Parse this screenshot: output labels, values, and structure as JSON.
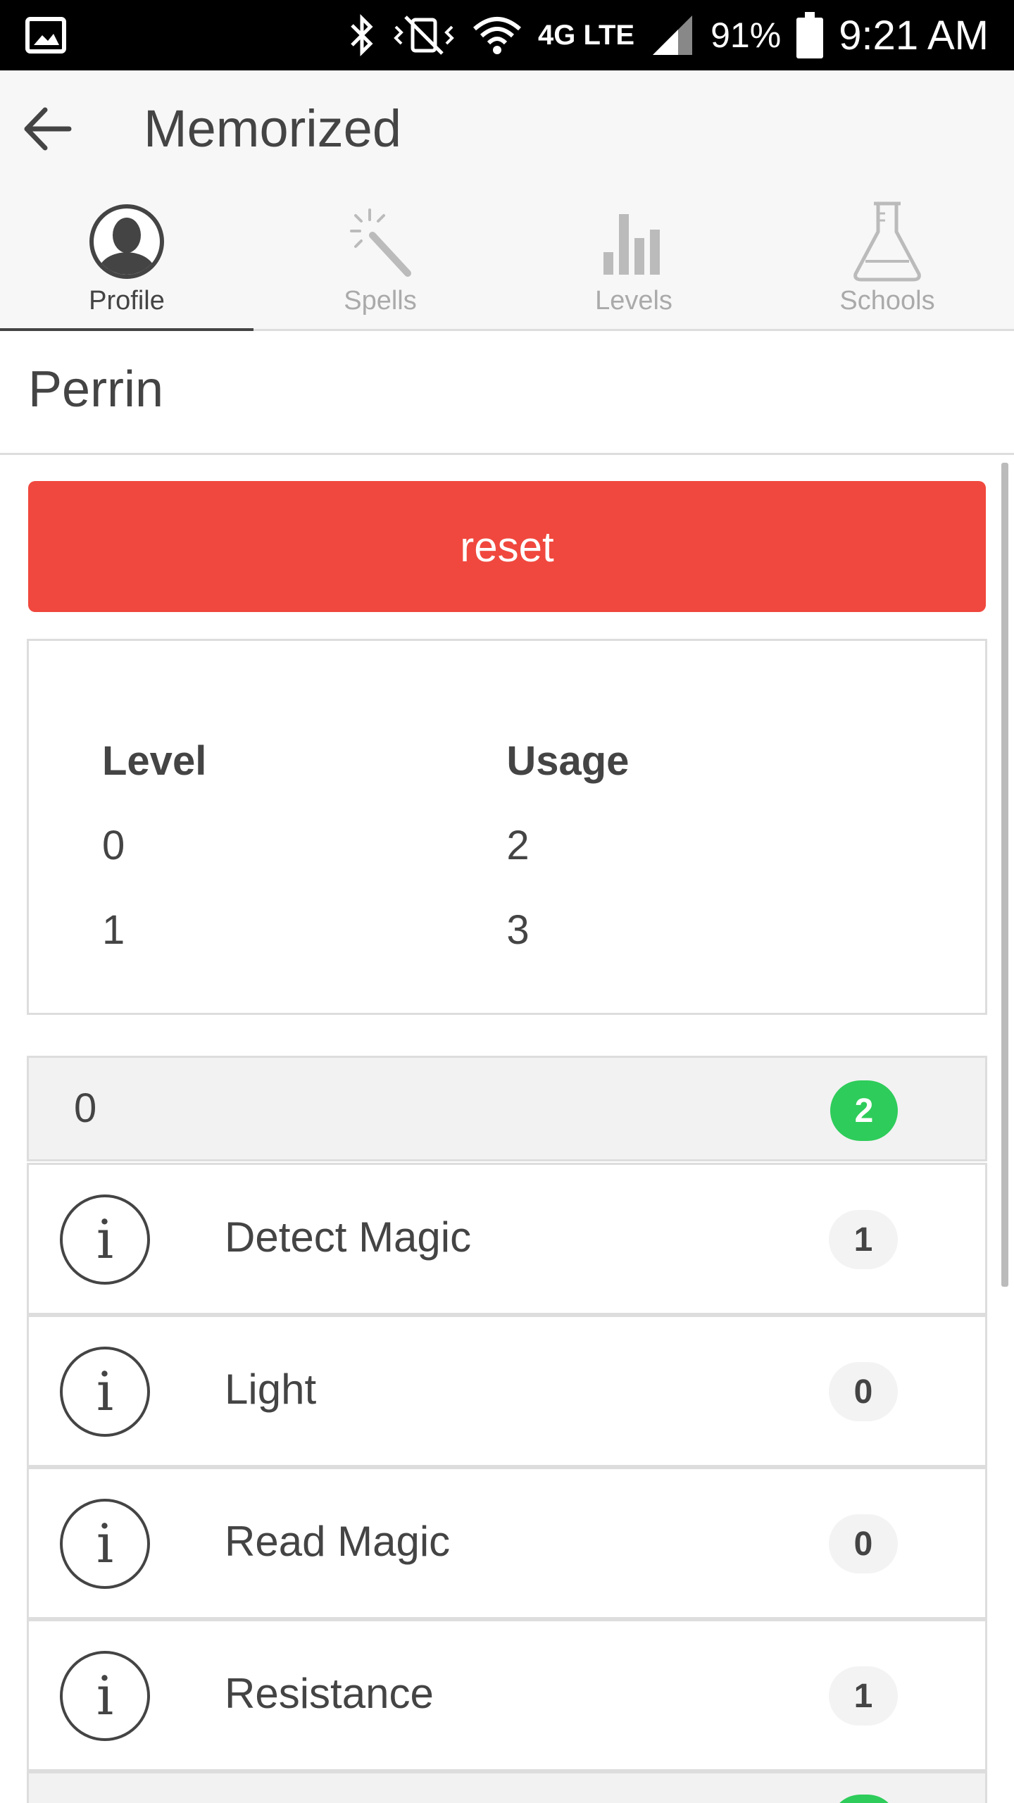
{
  "status_bar": {
    "battery_percent": "91%",
    "time": "9:21 AM",
    "network": "4G LTE"
  },
  "app_bar": {
    "title": "Memorized"
  },
  "tabs": [
    {
      "label": "Profile",
      "icon": "person-icon",
      "active": true
    },
    {
      "label": "Spells",
      "icon": "magic-wand-icon",
      "active": false
    },
    {
      "label": "Levels",
      "icon": "bar-chart-icon",
      "active": false
    },
    {
      "label": "Schools",
      "icon": "flask-icon",
      "active": false
    }
  ],
  "profile": {
    "name": "Perrin"
  },
  "reset_button": {
    "label": "reset",
    "color": "#f0483e"
  },
  "usage_table": {
    "headers": [
      "Level",
      "Usage"
    ],
    "rows": [
      [
        "0",
        "2"
      ],
      [
        "1",
        "3"
      ]
    ]
  },
  "level_group": {
    "level": "0",
    "count": "2",
    "badge_color": "#2ecc5a"
  },
  "spells": [
    {
      "name": "Detect Magic",
      "count": "1"
    },
    {
      "name": "Light",
      "count": "0"
    },
    {
      "name": "Read Magic",
      "count": "0"
    },
    {
      "name": "Resistance",
      "count": "1"
    }
  ]
}
